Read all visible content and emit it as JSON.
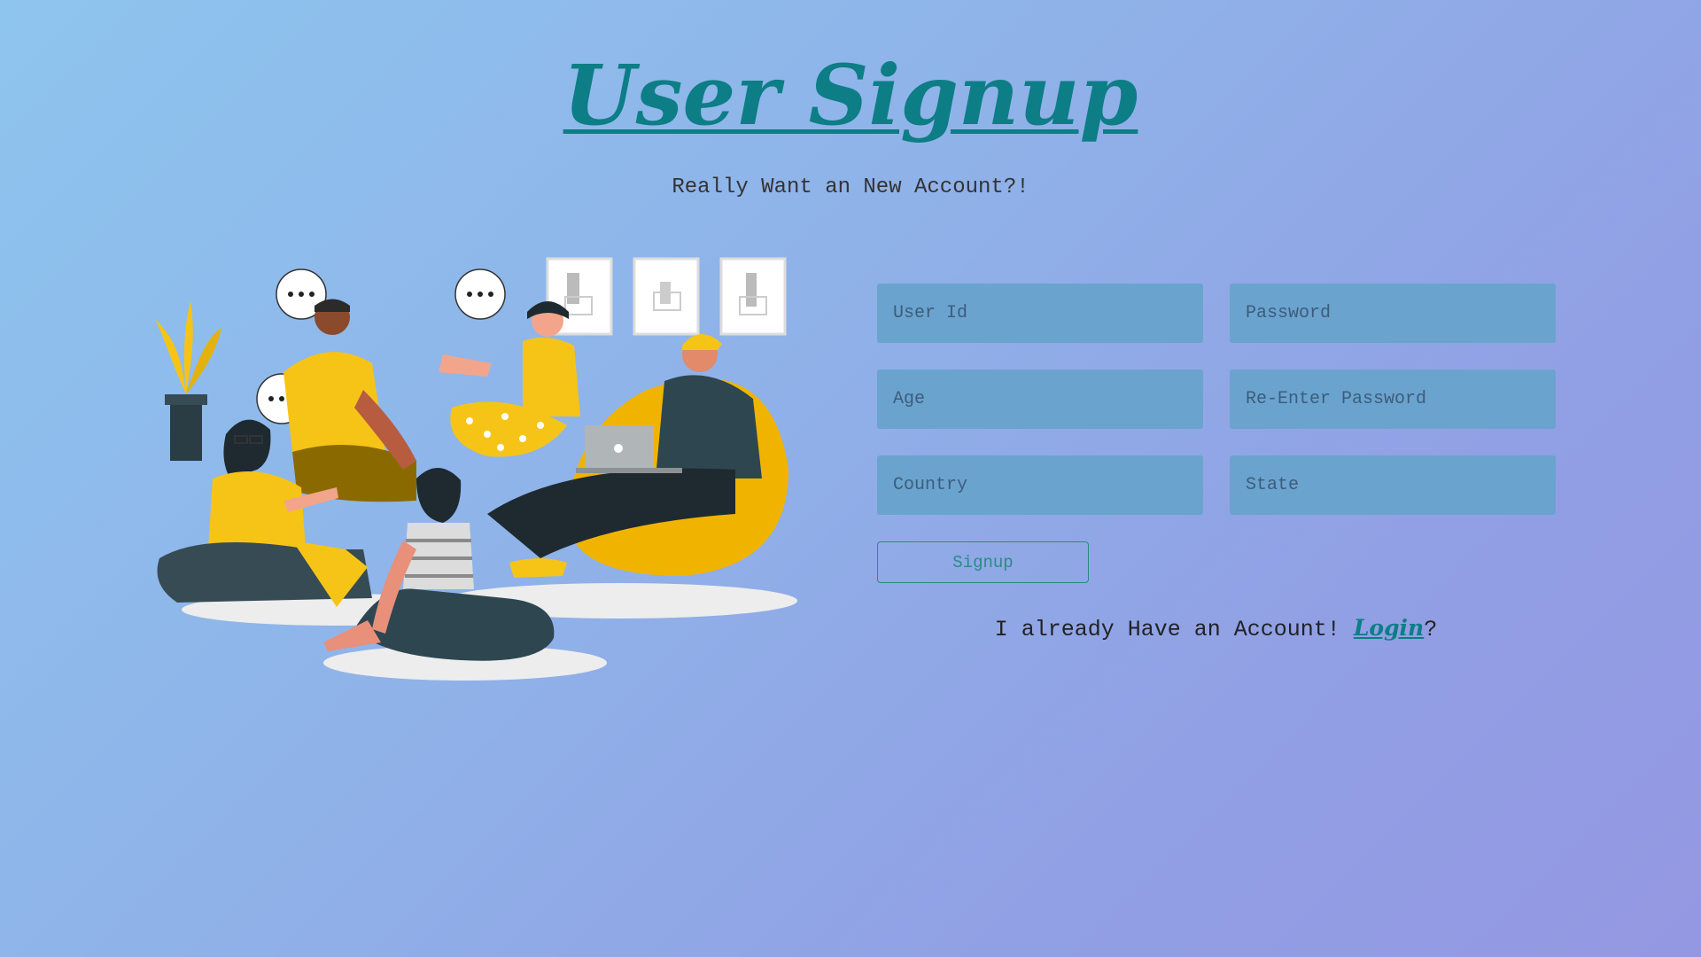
{
  "header": {
    "title": "User Signup",
    "subtitle": "Really Want an New Account?!"
  },
  "form": {
    "user_id_placeholder": "User Id",
    "password_placeholder": "Password",
    "age_placeholder": "Age",
    "reenter_password_placeholder": "Re-Enter Password",
    "country_placeholder": "Country",
    "state_placeholder": "State",
    "signup_label": "Signup"
  },
  "footer": {
    "prefix": "I already Have an Account! ",
    "login_label": "Login",
    "suffix": "?"
  },
  "illustration": {
    "icon": "group-chat-illustration",
    "speech_bubble_text": "..."
  },
  "colors": {
    "accent": "#0d7d86",
    "input_bg": "#6ba3cf",
    "yellow": "#f5c417",
    "dark": "#2e4650"
  }
}
